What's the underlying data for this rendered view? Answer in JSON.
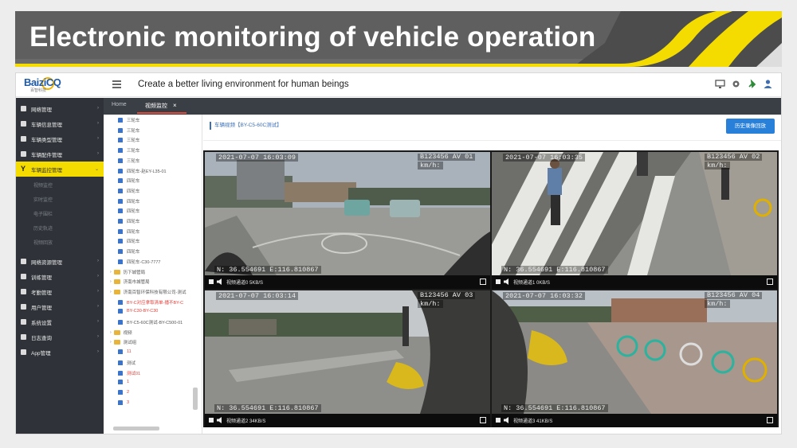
{
  "banner": {
    "title": "Electronic monitoring of vehicle operation"
  },
  "topbar": {
    "logo_text": "BaiziCQ",
    "logo_sub": "百智科技",
    "slogan": "Create a better living environment for human beings",
    "icons": [
      "monitor-icon",
      "gear-icon",
      "plug-icon",
      "user-icon"
    ]
  },
  "sidebar": {
    "items": [
      {
        "label": "网络管理",
        "icon": "network-icon"
      },
      {
        "label": "车辆信息管理",
        "icon": "vehicle-info-icon"
      },
      {
        "label": "车辆类型管理",
        "icon": "vehicle-type-icon"
      },
      {
        "label": "车辆配件管理",
        "icon": "parts-icon"
      },
      {
        "label": "车辆监控管理",
        "icon": "monitor-y-icon",
        "active": true
      },
      {
        "label": "网络资源管理",
        "icon": "resource-icon"
      },
      {
        "label": "训练管理",
        "icon": "training-icon"
      },
      {
        "label": "考勤管理",
        "icon": "attendance-icon"
      },
      {
        "label": "用户管理",
        "icon": "user-icon"
      },
      {
        "label": "系统设置",
        "icon": "settings-icon"
      },
      {
        "label": "日志查询",
        "icon": "log-icon"
      },
      {
        "label": "App管理",
        "icon": "app-icon"
      }
    ],
    "subitems": [
      "视频监控",
      "实时监控",
      "电子围栏",
      "历史轨迹",
      "视频回放"
    ]
  },
  "tabs": [
    {
      "label": "Home"
    },
    {
      "label": "视频监控",
      "active": true,
      "close": "×"
    }
  ],
  "tree": {
    "nodes": [
      {
        "label": "三轮车",
        "type": "user"
      },
      {
        "label": "三轮车",
        "type": "user"
      },
      {
        "label": "三轮车",
        "type": "user"
      },
      {
        "label": "三轮车",
        "type": "user"
      },
      {
        "label": "三轮车",
        "type": "user"
      },
      {
        "label": "四轮车-赵EY-L35-01",
        "type": "user"
      },
      {
        "label": "四轮车",
        "type": "user"
      },
      {
        "label": "四轮车",
        "type": "user"
      },
      {
        "label": "四轮车",
        "type": "user"
      },
      {
        "label": "四轮车",
        "type": "user"
      },
      {
        "label": "四轮车",
        "type": "user"
      },
      {
        "label": "四轮车",
        "type": "user"
      },
      {
        "label": "四轮车",
        "type": "user"
      },
      {
        "label": "四轮车",
        "type": "user"
      },
      {
        "label": "四轮车-C30-7777",
        "type": "user"
      },
      {
        "label": "历下城管局",
        "type": "folder"
      },
      {
        "label": "济南市城管局",
        "type": "folder"
      },
      {
        "label": "济南百智环保科技有限公司-测试",
        "type": "folder"
      },
      {
        "label": "BY-C对应拿取清单-播不BY-C",
        "type": "user",
        "red": true
      },
      {
        "label": "BY-C30-BY-C30",
        "type": "user",
        "red": true
      },
      {
        "label": "BY-C5-60C测试-BY-C500-01",
        "type": "user"
      },
      {
        "label": "视频",
        "type": "folder"
      },
      {
        "label": "测试组",
        "type": "folder"
      },
      {
        "label": "11",
        "type": "user",
        "red": true
      },
      {
        "label": "测试",
        "type": "user"
      },
      {
        "label": "测试01",
        "type": "user",
        "red": true
      },
      {
        "label": "1",
        "type": "user",
        "red": true
      },
      {
        "label": "2",
        "type": "user",
        "red": true
      },
      {
        "label": "3",
        "type": "user",
        "red": true
      }
    ]
  },
  "main": {
    "vehicle_label": "车辆视频【BY-C5-60C测试】",
    "switch_button": "历史录像回放",
    "channels": [
      {
        "timestamp": "2021-07-07 16:03:09",
        "plate": "B123456 AV 01",
        "speed": "km/h:",
        "coords": "N: 36.554691 E:116.810867",
        "name": "视频通道0 5KB/S"
      },
      {
        "timestamp": "2021-07-07 16:03:35",
        "plate": "B123456 AV 02",
        "speed": "km/h:",
        "coords": "N: 36.554691 E:116.810867",
        "name": "视频通道1 0KB/S"
      },
      {
        "timestamp": "2021-07-07 16:03:14",
        "plate": "B123456 AV 03",
        "speed": "km/h:",
        "coords": "N: 36.554691 E:116.810867",
        "name": "视频通道2 34KB/S"
      },
      {
        "timestamp": "2021-07-07 16:03:32",
        "plate": "B123456 AV 04",
        "speed": "km/h:",
        "coords": "N: 36.554691 E:116.810867",
        "name": "视频通道3 41KB/S"
      }
    ]
  },
  "colors": {
    "banner": "#5f5f5f",
    "banner_accent": "#f5dc00",
    "sidebar": "#2f3339",
    "active": "#f5dc00",
    "primary": "#2980d9",
    "tab_underline": "#e04a3a"
  }
}
